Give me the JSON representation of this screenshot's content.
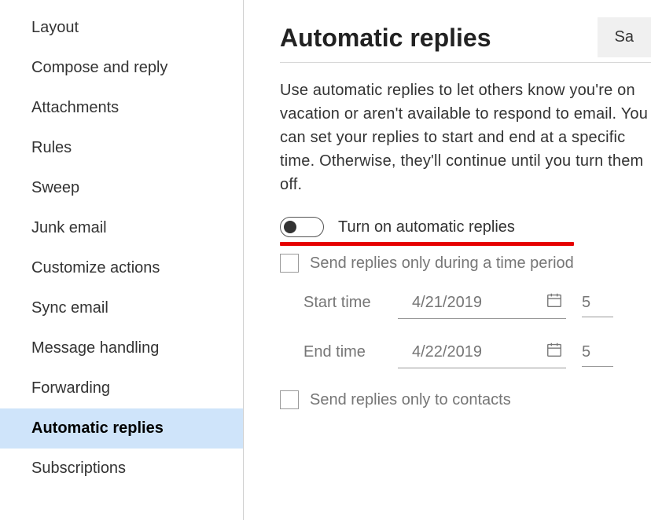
{
  "sidebar": {
    "items": [
      {
        "label": "Layout"
      },
      {
        "label": "Compose and reply"
      },
      {
        "label": "Attachments"
      },
      {
        "label": "Rules"
      },
      {
        "label": "Sweep"
      },
      {
        "label": "Junk email"
      },
      {
        "label": "Customize actions"
      },
      {
        "label": "Sync email"
      },
      {
        "label": "Message handling"
      },
      {
        "label": "Forwarding"
      },
      {
        "label": "Automatic replies"
      },
      {
        "label": "Subscriptions"
      }
    ]
  },
  "main": {
    "title": "Automatic replies",
    "save_label": "Sa",
    "description": "Use automatic replies to let others know you're on vacation or aren't available to respond to email. You can set your replies to start and end at a specific time. Otherwise, they'll continue until you turn them off.",
    "toggle_label": "Turn on automatic replies",
    "time_period_label": "Send replies only during a time period",
    "start_label": "Start time",
    "start_date": "4/21/2019",
    "start_time": "5",
    "end_label": "End time",
    "end_date": "4/22/2019",
    "end_time": "5",
    "contacts_label": "Send replies only to contacts"
  }
}
